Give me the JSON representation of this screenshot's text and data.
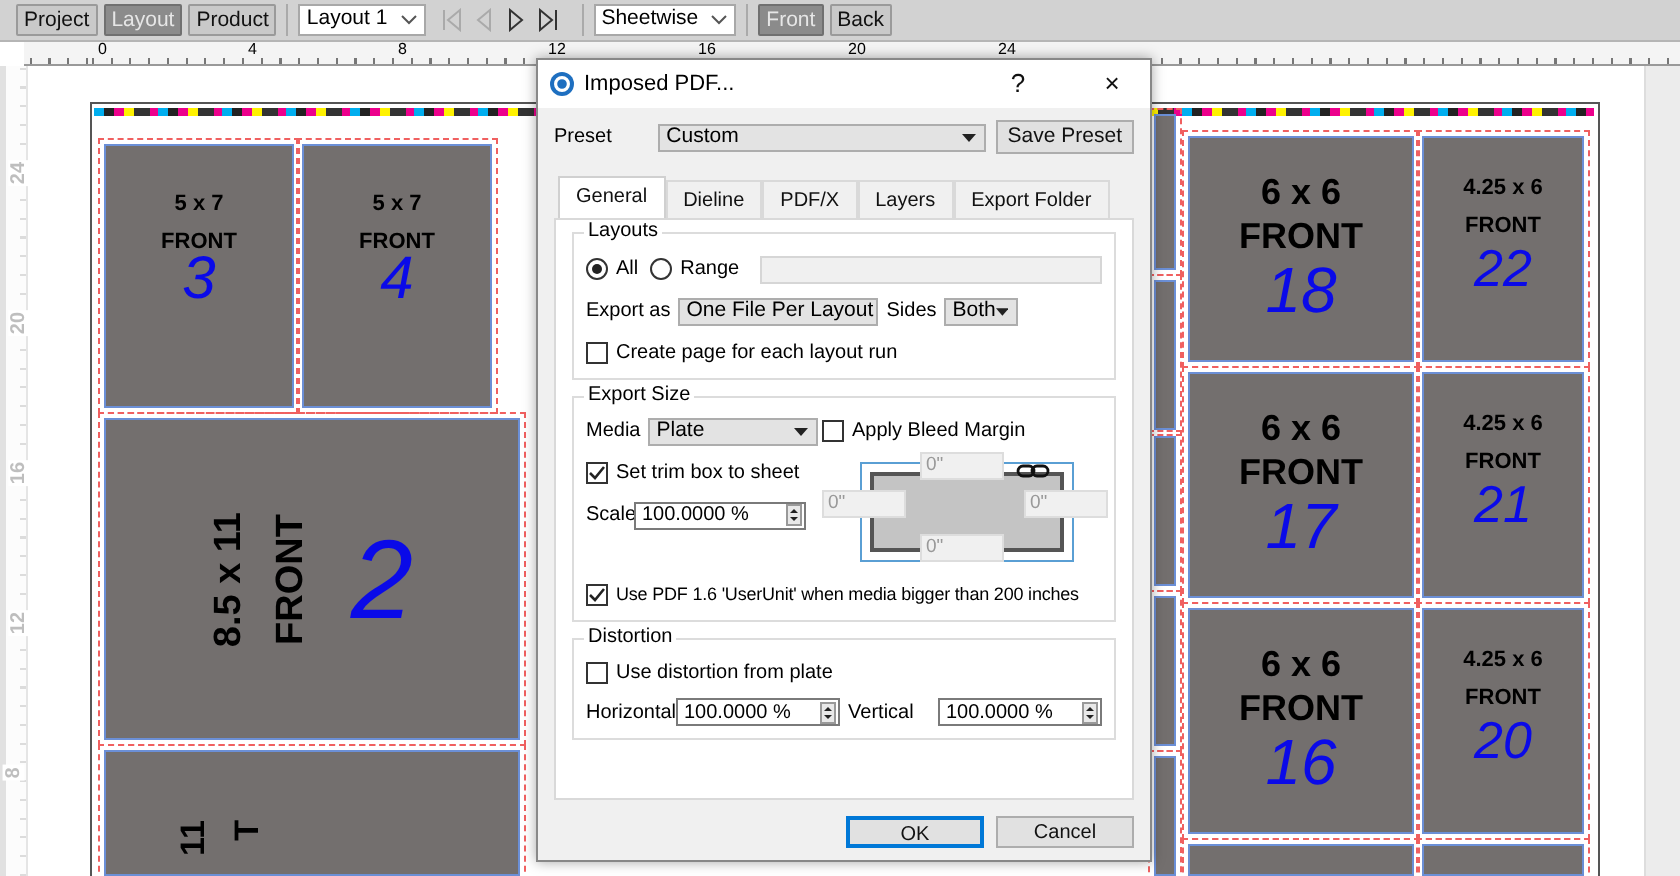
{
  "toolbar": {
    "mode_buttons": [
      {
        "label": "Project",
        "selected": false
      },
      {
        "label": "Layout",
        "selected": true
      },
      {
        "label": "Product",
        "selected": false
      }
    ],
    "layout_select": "Layout 1",
    "navigation": [
      {
        "kind": "first",
        "disabled": true
      },
      {
        "kind": "previous",
        "disabled": true
      },
      {
        "kind": "next",
        "disabled": false
      },
      {
        "kind": "last",
        "disabled": false
      }
    ],
    "side_mode_select": "Sheetwise",
    "side_buttons": [
      {
        "label": "Front",
        "selected": true
      },
      {
        "label": "Back",
        "selected": false
      }
    ]
  },
  "rulers": {
    "horizontal": [
      "0",
      "4",
      "8",
      "12",
      "16",
      "20",
      "24"
    ],
    "vertical": [
      "24",
      "20",
      "16",
      "12",
      "8"
    ]
  },
  "sheet": {
    "tiles": [
      {
        "kind": "upright",
        "size": "5 x 7",
        "side": "FRONT",
        "number": "3"
      },
      {
        "kind": "upright",
        "size": "5 x 7",
        "side": "FRONT",
        "number": "4"
      },
      {
        "kind": "rotated",
        "size": "8.5 x 11",
        "side": "FRONT",
        "number": "2"
      },
      {
        "kind": "rotated",
        "size": "11",
        "side": "T"
      },
      {
        "kind": "upright",
        "size": "6 x 6",
        "side": "FRONT",
        "number": "18"
      },
      {
        "kind": "upright",
        "size": "4.25 x 6",
        "side": "FRONT",
        "number": "22"
      },
      {
        "kind": "upright",
        "size": "6 x 6",
        "side": "FRONT",
        "number": "17"
      },
      {
        "kind": "upright",
        "size": "4.25 x 6",
        "side": "FRONT",
        "number": "21"
      },
      {
        "kind": "upright",
        "size": "6 x 6",
        "side": "FRONT",
        "number": "16"
      },
      {
        "kind": "upright",
        "size": "4.25 x 6",
        "side": "FRONT",
        "number": "20"
      },
      {
        "kind": "blank"
      },
      {
        "kind": "blank"
      },
      {
        "kind": "blank"
      },
      {
        "kind": "blank"
      },
      {
        "kind": "blank"
      },
      {
        "kind": "blank"
      },
      {
        "kind": "blank"
      }
    ]
  },
  "dialog": {
    "title": "Imposed PDF...",
    "help": "?",
    "close": "×",
    "preset": {
      "label": "Preset",
      "value": "Custom"
    },
    "save_preset": "Save Preset",
    "tabs": [
      {
        "label": "General",
        "selected": true
      },
      {
        "label": "Dieline",
        "selected": false
      },
      {
        "label": "PDF/X",
        "selected": false
      },
      {
        "label": "Layers",
        "selected": false
      },
      {
        "label": "Export Folder",
        "selected": false
      }
    ],
    "layouts": {
      "title": "Layouts",
      "options": [
        {
          "label": "All",
          "selected": true
        },
        {
          "label": "Range",
          "selected": false
        }
      ],
      "export_as": {
        "label": "Export as",
        "value": "One File Per Layout"
      },
      "sides": {
        "label": "Sides",
        "value": "Both"
      },
      "create_page": {
        "label": "Create page for each layout run",
        "checked": false
      }
    },
    "export_size": {
      "title": "Export Size",
      "media": {
        "label": "Media",
        "value": "Plate"
      },
      "apply_bleed": {
        "label": "Apply Bleed Margin",
        "checked": false
      },
      "set_trim": {
        "label": "Set trim box to sheet",
        "checked": true
      },
      "scale": {
        "label": "Scale",
        "value": "100.0000 %"
      },
      "margins": {
        "disabled": true,
        "top": "0\"",
        "left": "0\"",
        "right": "0\"",
        "bottom": "0\""
      },
      "use_userunit": {
        "label": "Use PDF 1.6 'UserUnit' when media bigger than 200 inches",
        "checked": true
      }
    },
    "distortion": {
      "title": "Distortion",
      "use_plate": {
        "label": "Use distortion from plate",
        "checked": false
      },
      "horizontal": {
        "label": "Horizontal",
        "value": "100.0000 %"
      },
      "vertical": {
        "label": "Vertical",
        "value": "100.0000 %"
      }
    },
    "buttons": [
      "OK",
      "Cancel"
    ]
  }
}
